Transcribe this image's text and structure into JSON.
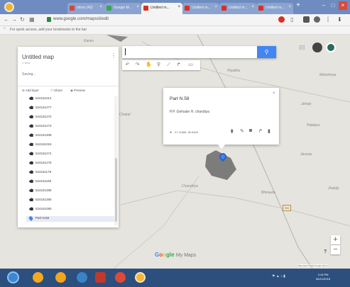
{
  "browser": {
    "tabs": [
      {
        "label": "Inbox (42)",
        "active": false,
        "favicon_color": "#d44638"
      },
      {
        "label": "Google M...",
        "active": false,
        "favicon_color": "#34a853"
      },
      {
        "label": "Untitled m...",
        "active": true,
        "favicon_color": "#d93025"
      },
      {
        "label": "Untitled m...",
        "active": false,
        "favicon_color": "#d93025"
      },
      {
        "label": "Untitled m...",
        "active": false,
        "favicon_color": "#d93025"
      },
      {
        "label": "Untitled m...",
        "active": false,
        "favicon_color": "#d93025"
      }
    ],
    "url": "www.google.com/maps/d/edit",
    "bookmark_hint": "For quick access, add your bookmarks to the bar"
  },
  "map": {
    "title": "Untitled map",
    "views": "1 view",
    "status": "Saving...",
    "actions": {
      "add_layer": "Add layer",
      "share": "Share",
      "preview": "Preview"
    },
    "places": [
      "Kanes",
      "Pipaltha",
      "Mahrinnya",
      "Chakal",
      "Chandriya",
      "Bhinauta",
      "Jaunau",
      "Jhalaly",
      "Jehaly",
      "Patalpur"
    ],
    "shield_label": "SH",
    "layer_items": [
      "524161014",
      "524161277",
      "524161272",
      "524161273",
      "524161308",
      "524161015",
      "524161274",
      "524161276",
      "524161179",
      "524161180",
      "524161288",
      "524161280",
      "524161090"
    ],
    "selected_item": "Part N.58",
    "popup": {
      "title": "Part N.58",
      "description": "P.P. Gehsale H. chandiya",
      "coords": "27.11668, 80.8463"
    },
    "logo": {
      "g1": "G",
      "g2": "o",
      "g3": "o",
      "g4": "gle",
      "suffix": "My Maps"
    },
    "attribution": "Map data ©2018 Google  Terms",
    "colors": {
      "accent": "#4285f4",
      "polygon": "#707070"
    }
  },
  "taskbar": {
    "clock_time": "3:15 PM",
    "clock_date": "06/12/2018"
  }
}
